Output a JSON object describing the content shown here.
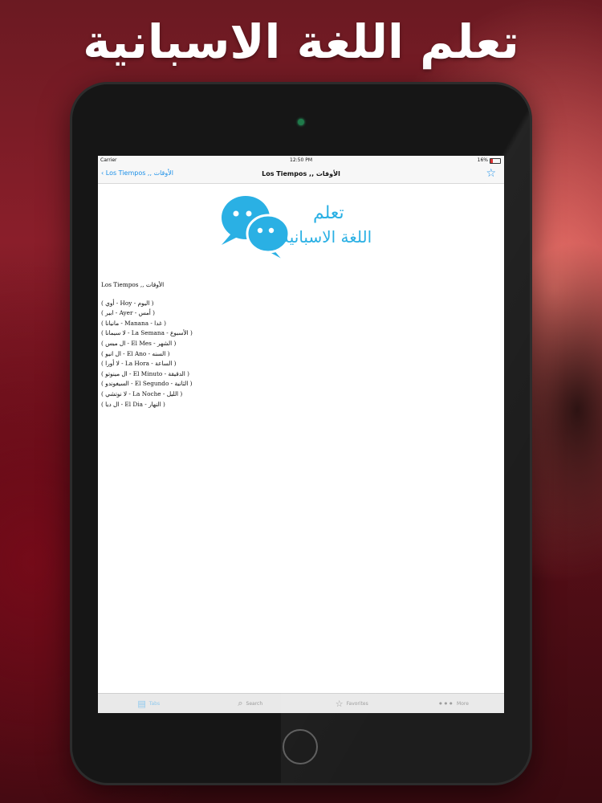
{
  "promo": {
    "title": "تعلم اللغة الاسبانية"
  },
  "status_bar": {
    "carrier": "Carrier",
    "time": "12:50 PM",
    "battery": "16%"
  },
  "nav": {
    "back_label": "Los Tiempos ,, الأوقات",
    "title": "Los Tiempos ,, الأوقات",
    "favorite_icon": "star-icon"
  },
  "logo": {
    "line1": "تعلم",
    "line2": "اللغة الاسبانية",
    "icon": "chat-bubbles-icon",
    "color": "#2ab0e4"
  },
  "content": {
    "heading": "Los Tiempos ,, الأوقات",
    "entries": [
      "( أوي - Hoy - اليوم )",
      "( ابير - Ayer - أمس )",
      "( مانيانا - Manana - غدا )",
      "( لا سيمانا - La Semana - الأسبوع )",
      "( ال ميس - El Mes - الشهر )",
      "( ال انيو - El Ano - السنه )",
      "( لا أورا - La Hora - الساعة )",
      "( ال مينوتو - El Minuto - الدقيقة )",
      "( السيغوندو - El Segundo - الثانية )",
      "( لا نوتشي - La Noche - الليل )",
      "( ال ديا - El Dia - النهار )"
    ]
  },
  "tabs": [
    {
      "label": "Tabs",
      "icon": "book-icon",
      "active": true
    },
    {
      "label": "Search",
      "icon": "search-icon",
      "active": false
    },
    {
      "label": "Favorites",
      "icon": "star-icon",
      "active": false
    },
    {
      "label": "More",
      "icon": "more-icon",
      "active": false
    }
  ],
  "colors": {
    "accent": "#1a8fe8",
    "logo": "#2ab0e4"
  }
}
